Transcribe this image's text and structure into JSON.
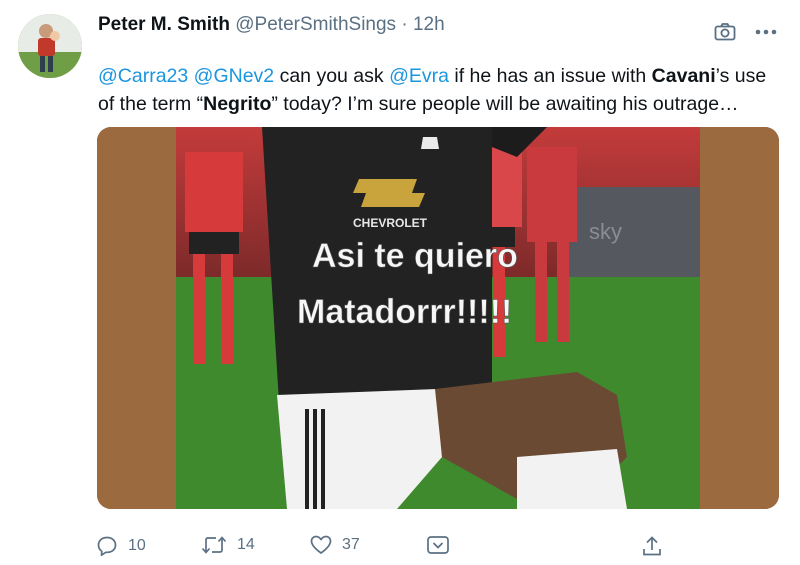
{
  "tweet": {
    "display_name": "Peter M. Smith",
    "handle": "@PeterSmithSings",
    "separator": "·",
    "time": "12h",
    "text_parts": [
      "@Carra23",
      " ",
      "@GNev2",
      " can you ask ",
      "@Evra",
      " if he has an issue with ",
      "Cavani",
      "’s use of the term “",
      "Negrito",
      "” today? I’m sure people will be awaiting his outrage…"
    ],
    "media_caption_line1": "Asi te quiero",
    "media_caption_line2": "Matadorrr!!!!!",
    "jersey_sponsor": "CHEVROLET",
    "icons": [
      "camera-icon",
      "more-icon",
      "reply-icon",
      "retweet-icon",
      "like-icon",
      "share-dropdown-icon",
      "upload-icon"
    ]
  },
  "actions": {
    "reply_count": "10",
    "retweet_count": "14",
    "like_count": "37"
  },
  "colors": {
    "link": "#1b95e0",
    "secondary_text": "#5b7083",
    "media_border": "#9b6a3e",
    "jersey": "#222222",
    "pitch": "#3f8a2c"
  }
}
